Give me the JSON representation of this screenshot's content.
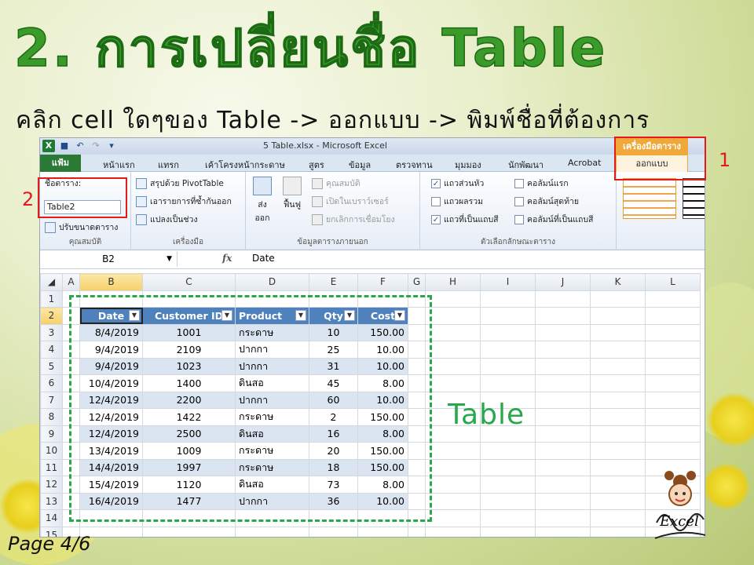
{
  "slide": {
    "title": "2. การเปลี่ยนชื่อ Table",
    "subtitle": "คลิก cell ใดๆของ Table -> ออกแบบ -> พิมพ์ชื่อที่ต้องการ",
    "page": "Page 4/6",
    "table_label": "Table",
    "callout_1": "1",
    "callout_2": "2",
    "mascot_text": "Excel"
  },
  "colors": {
    "title_green": "#3a9b2b",
    "callout_red": "#e41b1b",
    "dash_green": "#27a84a",
    "table_header": "#4f81bd",
    "band": "#dbe5f1"
  },
  "window": {
    "title": "5 Table.xlsx - Microsoft Excel",
    "context_group": "เครื่องมือตาราง"
  },
  "tabs": {
    "file": "แฟ้ม",
    "items": [
      "หน้าแรก",
      "แทรก",
      "เค้าโครงหน้ากระดาษ",
      "สูตร",
      "ข้อมูล",
      "ตรวจทาน",
      "มุมมอง",
      "นักพัฒนา",
      "Acrobat"
    ],
    "design": "ออกแบบ"
  },
  "ribbon": {
    "properties": {
      "name_label": "ชื่อตาราง:",
      "name_value": "Table2",
      "resize": "ปรับขนาดตาราง",
      "group": "คุณสมบัติ"
    },
    "tools": {
      "pivot": "สรุปด้วย PivotTable",
      "remove_dup": "เอารายการที่ซ้ำกันออก",
      "convert": "แปลงเป็นช่วง",
      "group": "เครื่องมือ"
    },
    "external": {
      "export": "ส่งออก",
      "refresh": "ฟื้นฟู",
      "props": "คุณสมบัติ",
      "browser": "เปิดในเบราว์เซอร์",
      "unlink": "ยกเลิกการเชื่อมโยง",
      "group": "ข้อมูลตารางภายนอก"
    },
    "options": {
      "header_row": "แถวส่วนหัว",
      "total_row": "แถวผลรวม",
      "banded_rows": "แถวที่เป็นแถบสี",
      "first_col": "คอลัมน์แรก",
      "last_col": "คอลัมน์สุดท้าย",
      "banded_cols": "คอลัมน์ที่เป็นแถบสี",
      "group": "ตัวเลือกลักษณะตาราง"
    }
  },
  "formula_bar": {
    "cell_ref": "B2",
    "fx": "fx",
    "value": "Date"
  },
  "grid": {
    "columns": [
      "A",
      "B",
      "C",
      "D",
      "E",
      "F",
      "G",
      "H",
      "I",
      "J",
      "K",
      "L"
    ],
    "headers": [
      "Date",
      "Customer ID",
      "Product",
      "Qty",
      "Cost"
    ],
    "rows": [
      [
        "8/4/2019",
        "1001",
        "กระดาษ",
        "10",
        "150.00"
      ],
      [
        "9/4/2019",
        "2109",
        "ปากกา",
        "25",
        "10.00"
      ],
      [
        "9/4/2019",
        "1023",
        "ปากกา",
        "31",
        "10.00"
      ],
      [
        "10/4/2019",
        "1400",
        "ดินสอ",
        "45",
        "8.00"
      ],
      [
        "12/4/2019",
        "2200",
        "ปากกา",
        "60",
        "10.00"
      ],
      [
        "12/4/2019",
        "1422",
        "กระดาษ",
        "2",
        "150.00"
      ],
      [
        "12/4/2019",
        "2500",
        "ดินสอ",
        "16",
        "8.00"
      ],
      [
        "13/4/2019",
        "1009",
        "กระดาษ",
        "20",
        "150.00"
      ],
      [
        "14/4/2019",
        "1997",
        "กระดาษ",
        "18",
        "150.00"
      ],
      [
        "15/4/2019",
        "1120",
        "ดินสอ",
        "73",
        "8.00"
      ],
      [
        "16/4/2019",
        "1477",
        "ปากกา",
        "36",
        "10.00"
      ]
    ]
  }
}
